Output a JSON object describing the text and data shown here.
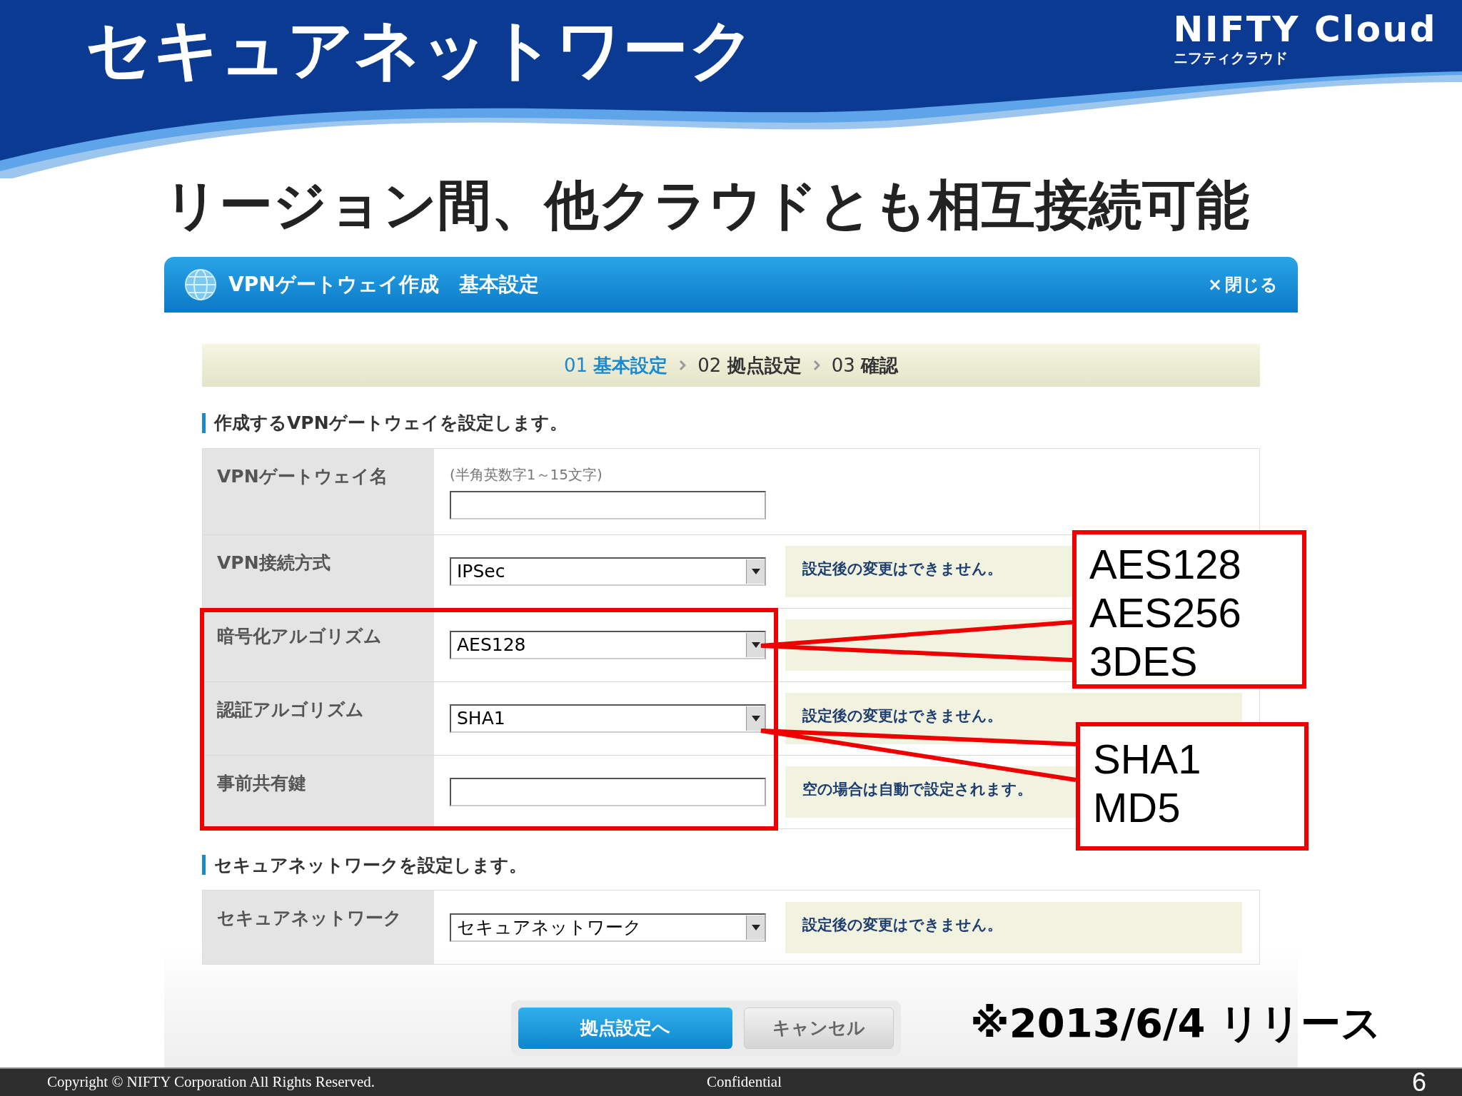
{
  "slide": {
    "title": "セキュアネットワーク",
    "logo": {
      "name": "NIFTY Cloud",
      "sub": "ニフティクラウド"
    },
    "subtitle": "リージョン間、他クラウドとも相互接続可能"
  },
  "dialog": {
    "title": "VPNゲートウェイ作成　基本設定",
    "close": {
      "icon": "×",
      "label": "閉じる"
    },
    "steps": [
      {
        "num": "01",
        "label": "基本設定",
        "selected": true
      },
      {
        "num": "02",
        "label": "拠点設定",
        "selected": false
      },
      {
        "num": "03",
        "label": "確認",
        "selected": false
      }
    ],
    "sections": [
      {
        "heading": "作成するVPNゲートウェイを設定します。",
        "rows": [
          {
            "label": "VPNゲートウェイ名",
            "kind": "text",
            "hint": "(半角英数字1～15文字)"
          },
          {
            "label": "VPN接続方式",
            "kind": "select",
            "value": "IPSec",
            "note": "設定後の変更はできません。"
          },
          {
            "label": "暗号化アルゴリズム",
            "kind": "select",
            "value": "AES128",
            "note_box": true
          },
          {
            "label": "認証アルゴリズム",
            "kind": "select",
            "value": "SHA1",
            "note": "設定後の変更はできません。"
          },
          {
            "label": "事前共有鍵",
            "kind": "text",
            "note": "空の場合は自動で設定されます。"
          }
        ]
      },
      {
        "heading": "セキュアネットワークを設定します。",
        "rows": [
          {
            "label": "セキュアネットワーク",
            "kind": "select",
            "value": "セキュアネットワーク",
            "note": "設定後の変更はできません。"
          }
        ]
      }
    ],
    "buttons": [
      {
        "label": "拠点設定へ",
        "kind": "primary"
      },
      {
        "label": "キャンセル",
        "kind": "secondary"
      }
    ]
  },
  "callouts": [
    {
      "options": [
        "AES128",
        "AES256",
        "3DES"
      ]
    },
    {
      "options": [
        "SHA1",
        "MD5"
      ]
    }
  ],
  "release_note": "※2013/6/4 リリース",
  "footer": {
    "copyright": "Copyright © NIFTY Corporation All Rights Reserved.",
    "center": "Confidential",
    "page": "6"
  }
}
